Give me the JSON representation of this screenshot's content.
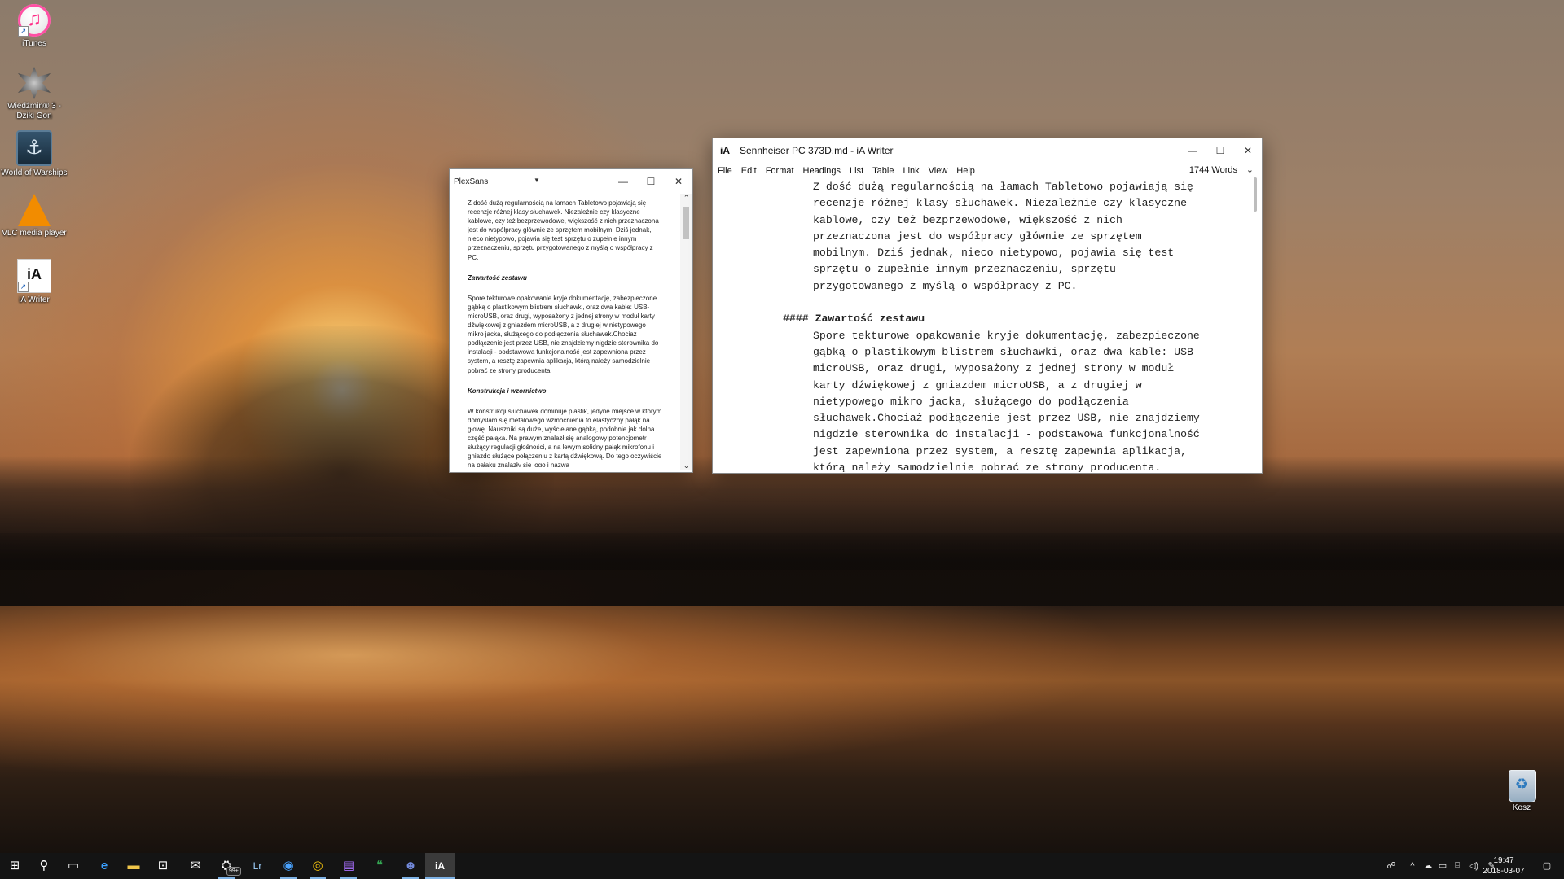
{
  "desktop": {
    "icons": [
      {
        "label": "iTunes",
        "icon": "itunes-icon"
      },
      {
        "label": "Wiedźmin® 3 - Dziki Gon",
        "icon": "witcher-icon"
      },
      {
        "label": "World of Warships",
        "icon": "warships-icon"
      },
      {
        "label": "VLC media player",
        "icon": "vlc-icon"
      },
      {
        "label": "iA Writer",
        "icon": "ia-writer-icon"
      }
    ],
    "recycle_bin": {
      "label": "Kosz",
      "icon": "recycle-bin-icon"
    }
  },
  "preview_window": {
    "title": "PlexSans",
    "dropdown_glyph": "▼",
    "controls": {
      "minimize": "—",
      "maximize": "☐",
      "close": "✕"
    },
    "scroll_up": "⌃",
    "scroll_down": "⌄",
    "paragraph_1": "Z dość dużą regularnością na łamach Tabletowo pojawiają się recenzje różnej klasy słuchawek. Niezależnie czy klasyczne kablowe, czy też bezprzewodowe, większość z nich przeznaczona jest do współpracy głównie ze sprzętem mobilnym. Dziś jednak, nieco nietypowo, pojawia się test sprzętu o zupełnie innym przeznaczeniu, sprzętu przygotowanego z myślą o współpracy z PC.",
    "heading_1": "Zawartość zestawu",
    "paragraph_2": "Spore tekturowe opakowanie kryje dokumentację, zabezpieczone gąbką o plastikowym blistrem słuchawki, oraz dwa kable: USB-microUSB, oraz drugi, wyposażony z jednej strony w moduł karty dźwiękowej z gniazdem microUSB, a z drugiej w nietypowego mikro jacka, służącego do podłączenia słuchawek.Chociaż podłączenie jest przez USB, nie znajdziemy nigdzie sterownika do instalacji - podstawowa funkcjonalność jest zapewniona przez system, a resztę zapewnia aplikacja, którą należy samodzielnie pobrać ze strony producenta.",
    "heading_2": "Konstrukcja i wzornictwo",
    "paragraph_3": "W konstrukcji słuchawek dominuje plastik, jedyne miejsce w którym domyślam się metalowego wzmocnienia to elastyczny pałąk na głowę. Nauszniki są duże, wyścielane gąbką, podobnie jak dolna część pałąka. Na prawym znalazł się analogowy potencjometr służący regulacji głośności, a na lewym solidny pałąk mikrofonu i gniazdo służące połączeniu z kartą dźwiękową. Do tego oczywiście na pałąku znalazły się logo i nazwa"
  },
  "writer_window": {
    "app_icon": "iA",
    "title": "Sennheiser PC 373D.md - iA Writer",
    "controls": {
      "minimize": "—",
      "maximize": "☐",
      "close": "✕"
    },
    "menu": [
      "File",
      "Edit",
      "Format",
      "Headings",
      "List",
      "Table",
      "Link",
      "View",
      "Help"
    ],
    "word_count": "1744 Words",
    "word_count_chevron": "⌄",
    "paragraph_1": "Z dość dużą regularnością na łamach Tabletowo pojawiają się recenzje różnej klasy słuchawek. Niezależnie czy klasyczne kablowe, czy też bezprzewodowe, większość z nich przeznaczona jest do współpracy głównie ze sprzętem mobilnym. Dziś jednak, nieco nietypowo, pojawia się test sprzętu o zupełnie innym przeznaczeniu, sprzętu przygotowanego z myślą o współpracy z PC.",
    "heading_marker": "####",
    "heading_text": "Zawartość zestawu",
    "paragraph_2": "Spore tekturowe opakowanie kryje dokumentację, zabezpieczone gąbką o plastikowym blistrem słuchawki, oraz dwa kable: USB-microUSB, oraz drugi, wyposażony z jednej strony w moduł karty dźwiękowej z gniazdem microUSB, a z drugiej w nietypowego mikro jacka, służącego do podłączenia słuchawek.Chociaż podłączenie jest przez USB, nie znajdziemy nigdzie sterownika do instalacji - podstawowa funkcjonalność jest zapewniona przez system, a resztę zapewnia aplikacja, którą należy samodzielnie pobrać ze strony producenta."
  },
  "taskbar": {
    "start_glyph": "⊞",
    "search_glyph": "⚲",
    "task_view_glyph": "▭",
    "apps": [
      {
        "name": "edge",
        "glyph": "e"
      },
      {
        "name": "file-explorer",
        "glyph": "▬"
      },
      {
        "name": "store",
        "glyph": "⊡"
      },
      {
        "name": "mail",
        "glyph": "✉"
      },
      {
        "name": "steam",
        "glyph": "⛭",
        "badge": "99+"
      },
      {
        "name": "lightroom",
        "glyph": "Lr"
      },
      {
        "name": "messenger",
        "glyph": "◉"
      },
      {
        "name": "chrome",
        "glyph": "◎"
      },
      {
        "name": "twitch",
        "glyph": "▤"
      },
      {
        "name": "hangouts",
        "glyph": "❝"
      },
      {
        "name": "discord",
        "glyph": "☻"
      },
      {
        "name": "ia-writer",
        "glyph": "iA"
      }
    ],
    "tray": [
      {
        "name": "people",
        "glyph": "☍"
      },
      {
        "name": "show-hidden",
        "glyph": "^"
      },
      {
        "name": "onedrive",
        "glyph": "☁"
      },
      {
        "name": "display",
        "glyph": "▭"
      },
      {
        "name": "network",
        "glyph": "⌸"
      },
      {
        "name": "volume",
        "glyph": "◁)"
      },
      {
        "name": "pen",
        "glyph": "✎"
      }
    ],
    "time": "19:47",
    "date": "2018-03-07",
    "notification_glyph": "▢"
  }
}
